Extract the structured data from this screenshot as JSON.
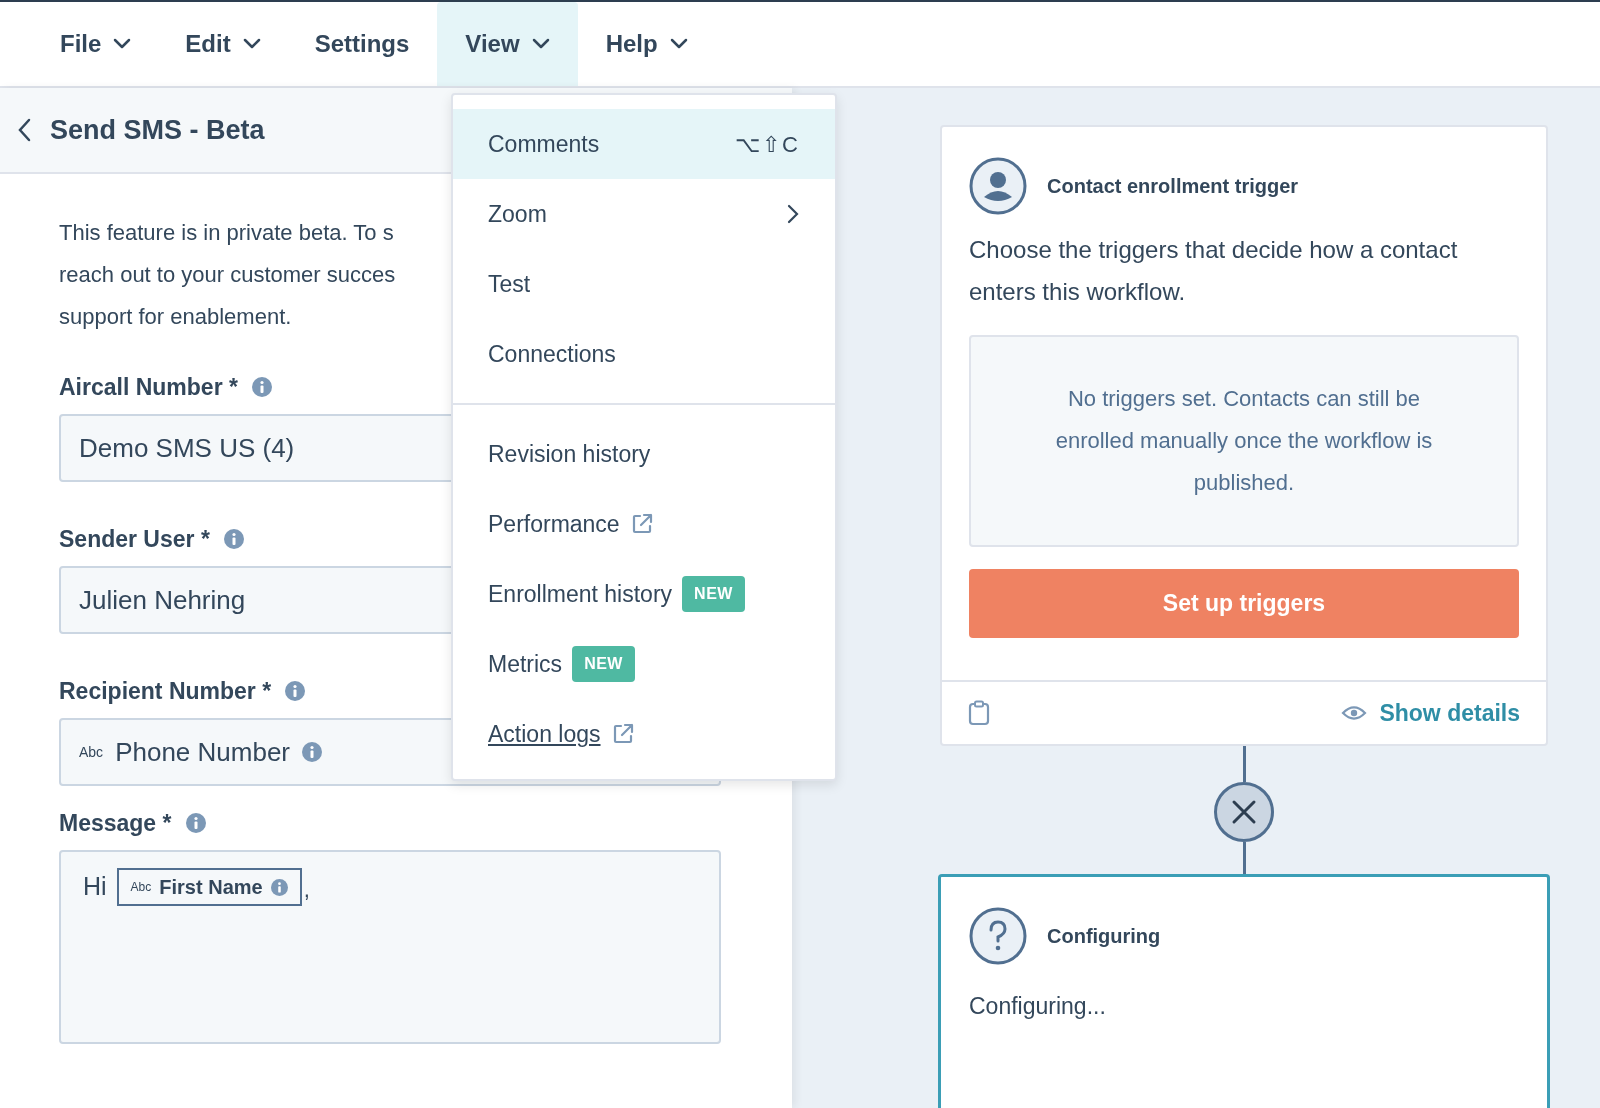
{
  "menu_bar": [
    {
      "label": "File",
      "dropdown": true,
      "selected": false
    },
    {
      "label": "Edit",
      "dropdown": true,
      "selected": false
    },
    {
      "label": "Settings",
      "dropdown": false,
      "selected": false
    },
    {
      "label": "View",
      "dropdown": true,
      "selected": true
    },
    {
      "label": "Help",
      "dropdown": true,
      "selected": false
    }
  ],
  "panel": {
    "title": "Send SMS - Beta",
    "intro_lines": [
      "This feature is in private beta. To s",
      "reach out to your customer succes",
      "support for enablement."
    ],
    "fields": [
      {
        "kind": "text",
        "label": "Aircall Number *",
        "value": "Demo SMS US (4)"
      },
      {
        "kind": "text",
        "label": "Sender User *",
        "value": "Julien Nehring"
      },
      {
        "kind": "token",
        "label": "Recipient Number *",
        "token_type": "Abc",
        "value": "Phone Number"
      },
      {
        "kind": "message",
        "label": "Message *",
        "before": "Hi",
        "token_type": "Abc",
        "token": "First Name",
        "after": ","
      }
    ]
  },
  "view_menu": {
    "sections": [
      [
        {
          "label": "Comments",
          "kind": "shortcut",
          "shortcut": "⌥⇧C",
          "selected": true
        },
        {
          "label": "Zoom",
          "kind": "submenu",
          "selected": false
        },
        {
          "label": "Test",
          "kind": "plain",
          "selected": false
        },
        {
          "label": "Connections",
          "kind": "plain",
          "selected": false
        }
      ],
      [
        {
          "label": "Revision history",
          "kind": "plain",
          "selected": false
        },
        {
          "label": "Performance",
          "kind": "external",
          "selected": false
        },
        {
          "label": "Enrollment history",
          "kind": "badge",
          "badge": "NEW",
          "selected": false
        },
        {
          "label": "Metrics",
          "kind": "badge",
          "badge": "NEW",
          "selected": false
        },
        {
          "label": "Action logs",
          "kind": "link",
          "selected": false
        }
      ]
    ]
  },
  "trigger_card": {
    "title": "Contact enrollment trigger",
    "description": "Choose the triggers that decide how a contact enters this workflow.",
    "empty_message": "No triggers set. Contacts can still be enrolled manually once the workflow is published.",
    "button": "Set up triggers",
    "footer_link": "Show details"
  },
  "action_card": {
    "title": "Configuring",
    "body": "Configuring...",
    "selected": true
  }
}
